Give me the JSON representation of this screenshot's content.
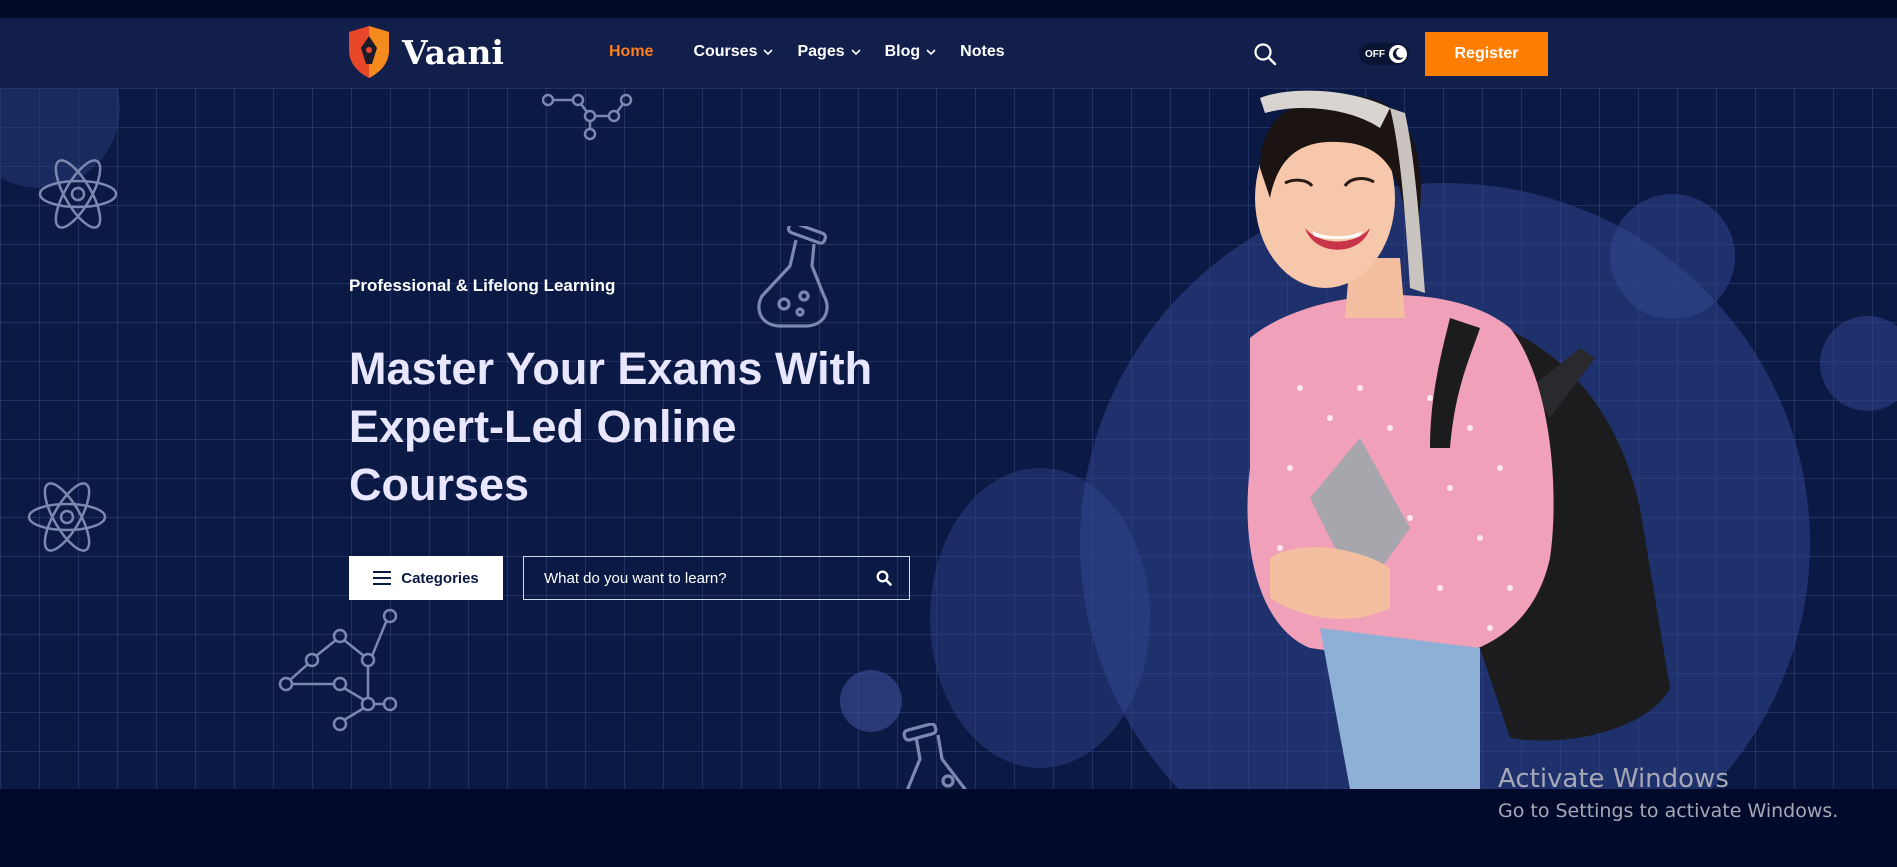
{
  "brand": {
    "name": "Vaani"
  },
  "nav": {
    "items": [
      {
        "label": "Home",
        "active": true,
        "dropdown": false
      },
      {
        "label": "Courses",
        "active": false,
        "dropdown": true
      },
      {
        "label": "Pages",
        "active": false,
        "dropdown": true
      },
      {
        "label": "Blog",
        "active": false,
        "dropdown": true
      },
      {
        "label": "Notes",
        "active": false,
        "dropdown": false
      }
    ],
    "theme_toggle_label": "OFF",
    "register_label": "Register"
  },
  "hero": {
    "eyebrow": "Professional & Lifelong Learning",
    "headline": "Master Your Exams With Expert-Led Online Courses",
    "categories_label": "Categories",
    "search_placeholder": "What do you want to learn?"
  },
  "watermark": {
    "line1": "Activate Windows",
    "line2": "Go to Settings to activate Windows."
  },
  "colors": {
    "accent": "#ff7d00",
    "navbar": "#111f4a",
    "hero_bg": "#0b1945"
  }
}
